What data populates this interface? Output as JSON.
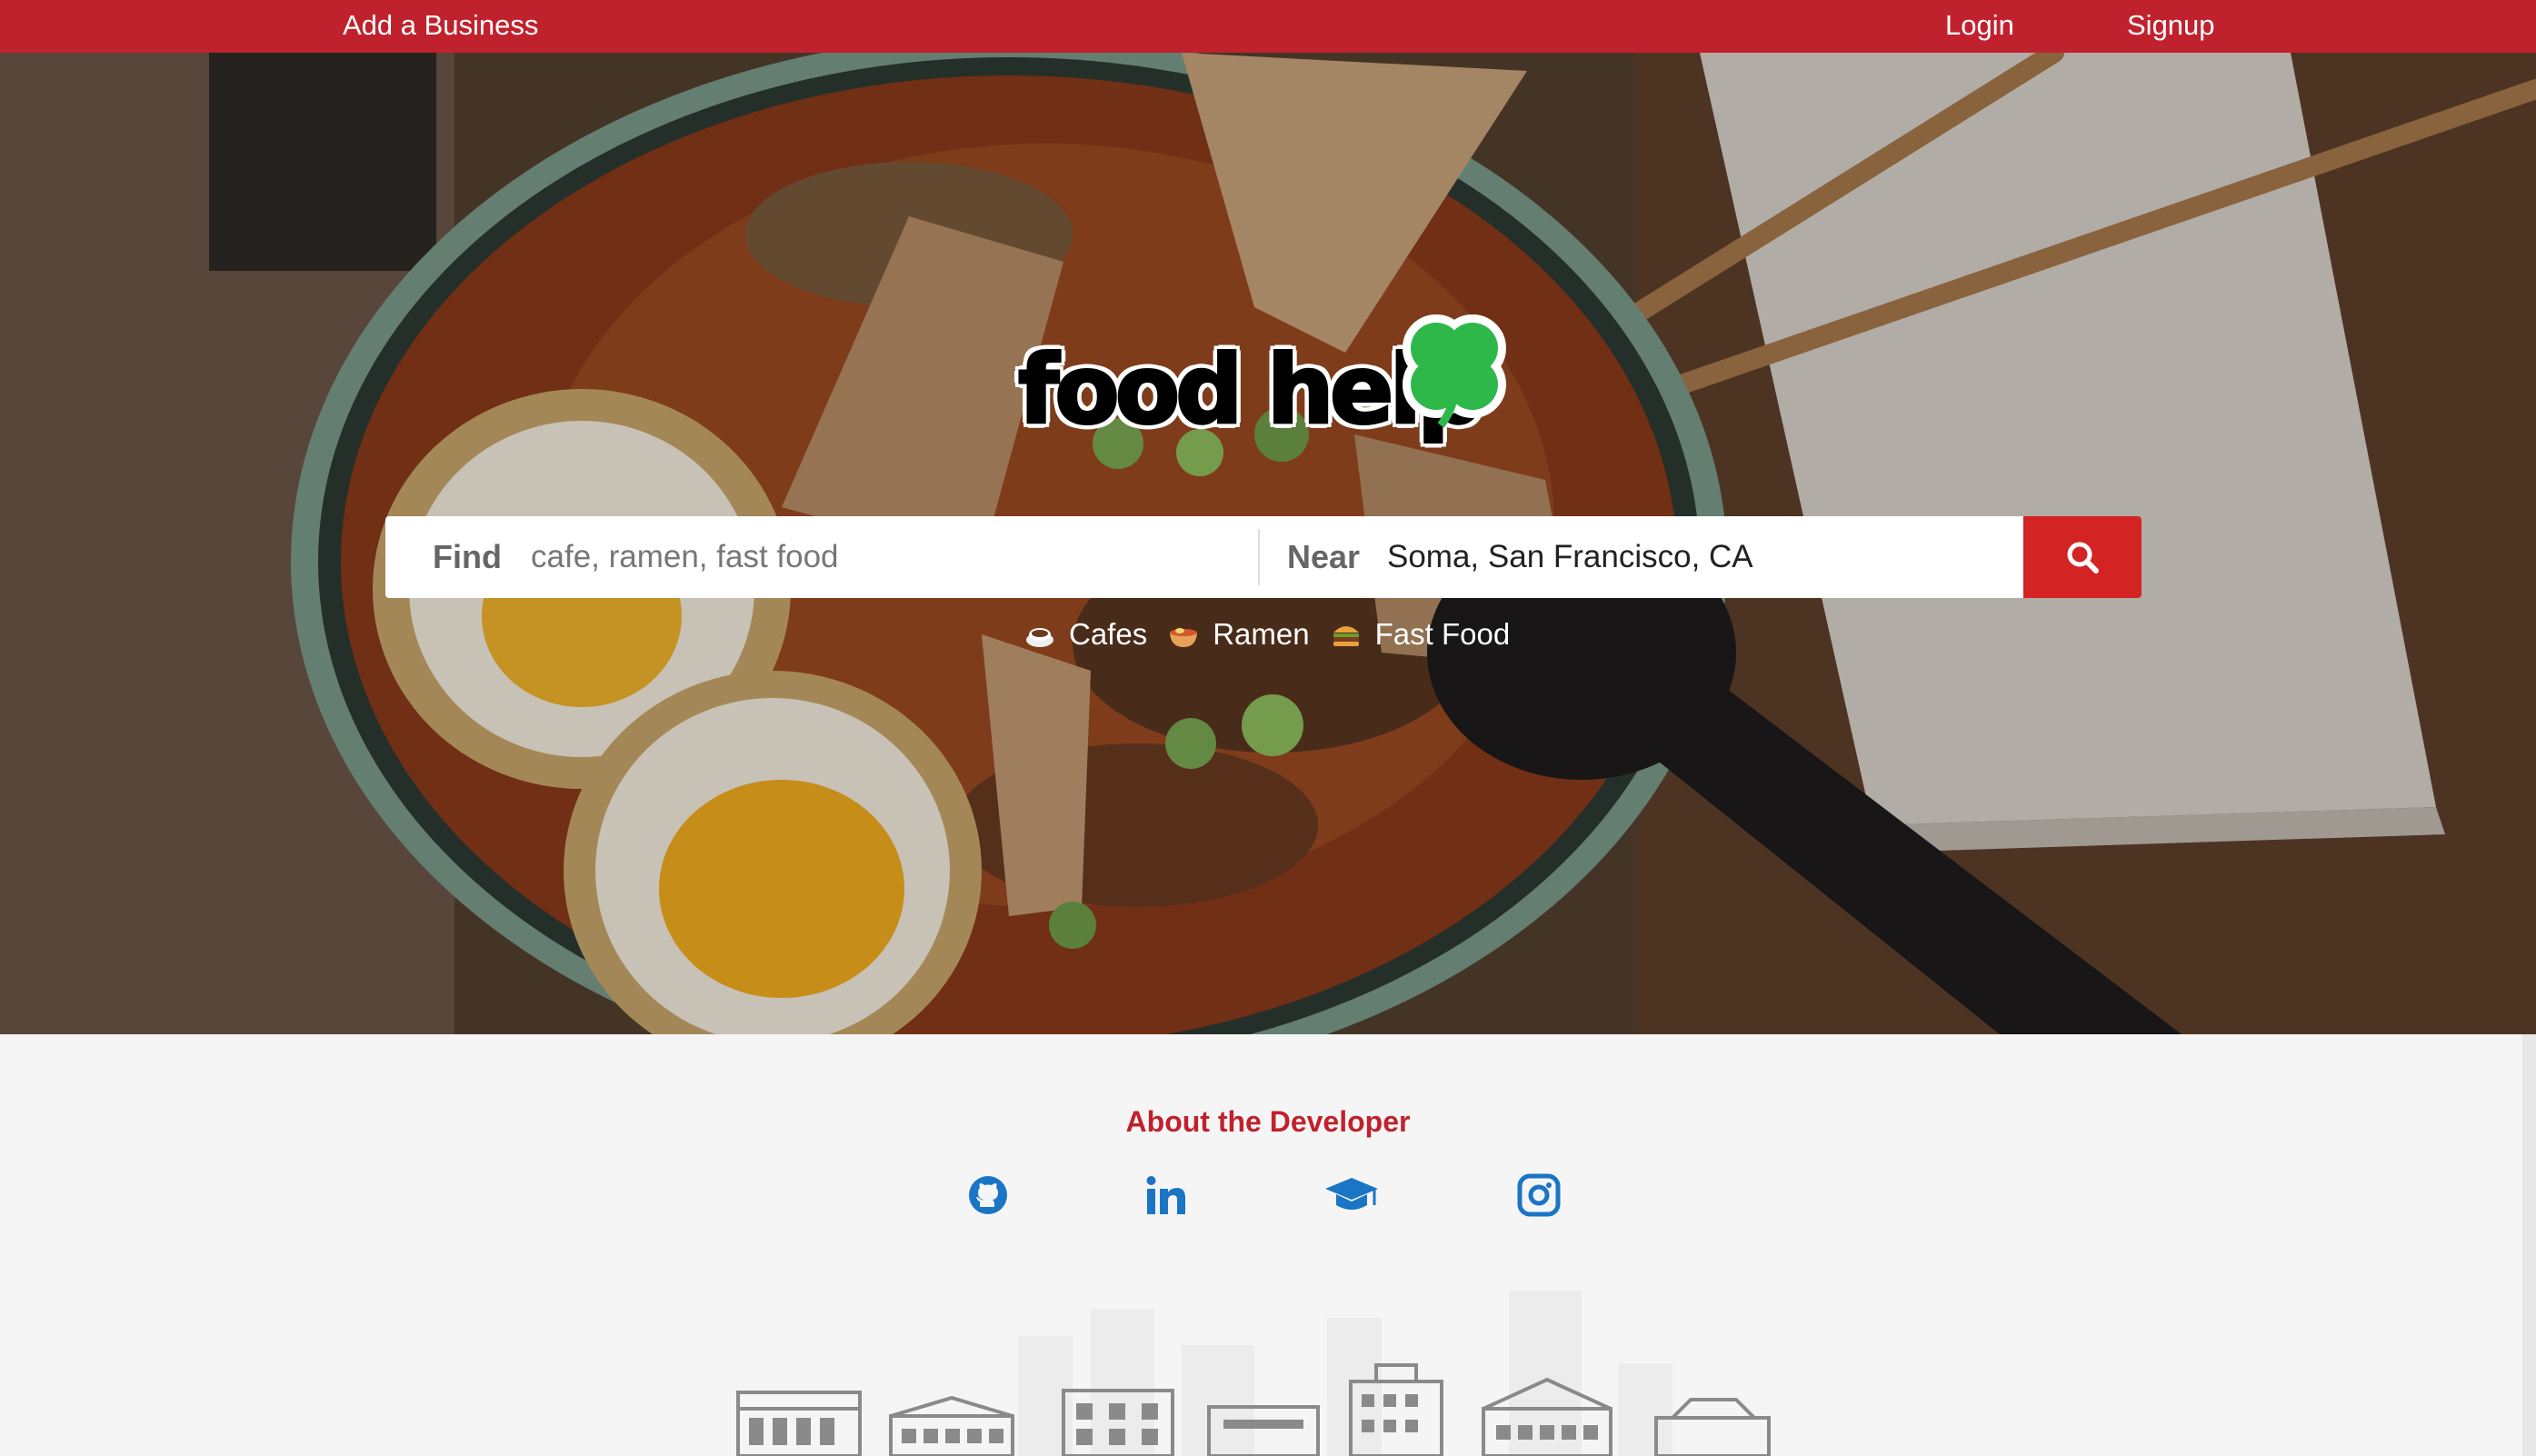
{
  "nav": {
    "add_business": "Add a Business",
    "login": "Login",
    "signup": "Signup"
  },
  "brand": {
    "logo_text": "food help",
    "logo_icon": "clover-icon"
  },
  "search": {
    "find_label": "Find",
    "find_placeholder": "cafe, ramen, fast food",
    "near_label": "Near",
    "near_value": "Soma, San Francisco, CA",
    "button_icon": "search-icon"
  },
  "categories": [
    {
      "label": "Cafes",
      "icon": "coffee-icon"
    },
    {
      "label": "Ramen",
      "icon": "ramen-bowl-icon"
    },
    {
      "label": "Fast Food",
      "icon": "burger-icon"
    }
  ],
  "footer": {
    "title": "About the Developer",
    "links": [
      "github-icon",
      "linkedin-icon",
      "graduation-cap-icon",
      "instagram-icon"
    ]
  },
  "colors": {
    "brand_red": "#c0222d",
    "button_red": "#d32323",
    "link_blue": "#1a75c4"
  }
}
